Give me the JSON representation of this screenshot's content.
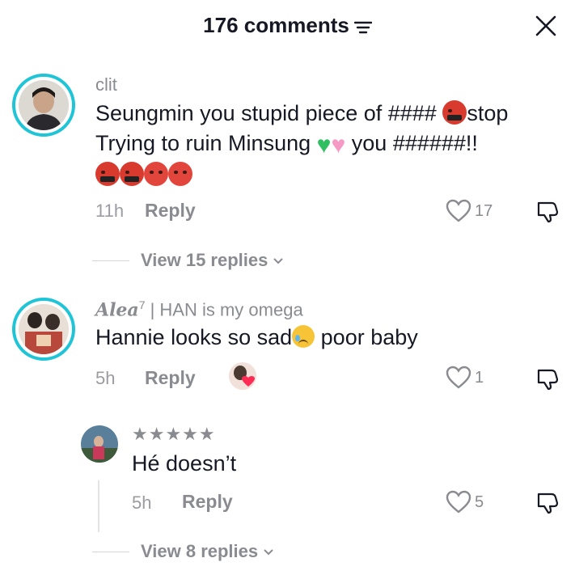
{
  "header": {
    "title": "176 comments",
    "filter_icon": "filter-icon",
    "close_icon": "close-icon"
  },
  "comments": [
    {
      "username": "clit",
      "text_line1": "Seungmin you stupid piece of ####",
      "text_line1_end": "stop",
      "text_line2_start": "Trying to ruin Minsung",
      "text_line2_end": "you ######!!",
      "time": "11h",
      "reply_label": "Reply",
      "likes": "17",
      "view_replies": "View 15 replies"
    },
    {
      "username_styled": "Alea",
      "username_sup": "7",
      "username_rest": " | HAN is my omega",
      "text_start": "Hannie looks so sad",
      "text_end": " poor baby",
      "time": "5h",
      "reply_label": "Reply",
      "likes": "1"
    },
    {
      "username": "★★★★★",
      "text": "Hé doesn’t",
      "time": "5h",
      "reply_label": "Reply",
      "likes": "5",
      "view_replies": "View 8 replies"
    }
  ],
  "colors": {
    "avatar_ring": "#20c4d7",
    "secondary_text": "#8a8b91",
    "primary_text": "#161823"
  }
}
